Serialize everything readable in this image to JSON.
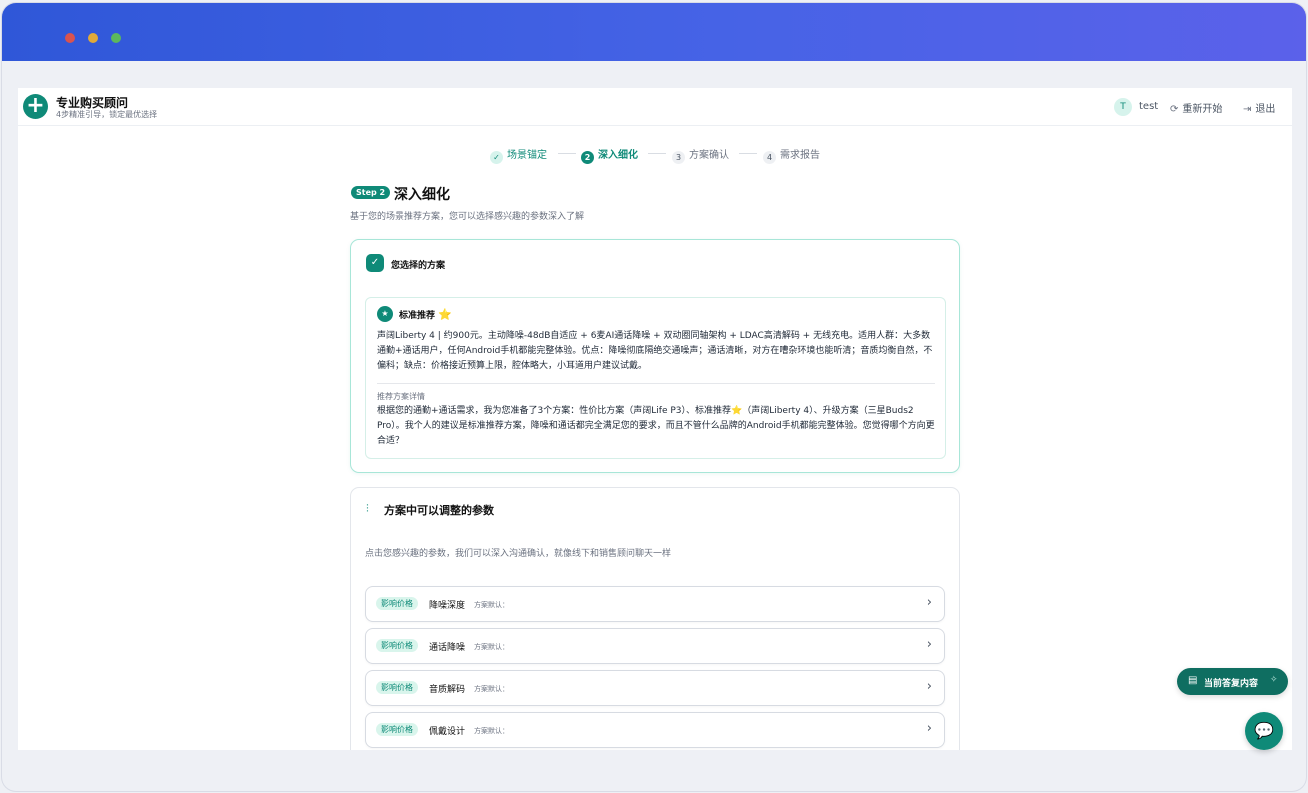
{
  "header": {
    "app_title": "专业购买顾问",
    "app_subtitle": "4步精准引导，锁定最优选择",
    "user_initial": "T",
    "user_name": "test",
    "restart_label": "重新开始",
    "logout_label": "退出"
  },
  "stepper": [
    {
      "num": "✓",
      "label": "场景锚定"
    },
    {
      "num": "2",
      "label": "深入细化"
    },
    {
      "num": "3",
      "label": "方案确认"
    },
    {
      "num": "4",
      "label": "需求报告"
    }
  ],
  "step": {
    "badge": "Step 2",
    "title": "深入细化",
    "desc": "基于您的场景推荐方案，您可以选择感兴趣的参数深入了解"
  },
  "selected_plan": {
    "card_title": "您选择的方案",
    "rec_title": "标准推荐",
    "rec_body": "声阔Liberty 4 | 约900元。主动降噪-48dB自适应 + 6麦AI通话降噪 + 双动圈同轴架构 + LDAC高清解码 + 无线充电。适用人群：大多数通勤+通话用户，任何Android手机都能完整体验。优点：降噪彻底隔绝交通噪声；通话清晰，对方在嘈杂环境也能听清；音质均衡自然，不偏科；缺点：价格接近预算上限，腔体略大，小耳道用户建议试戴。",
    "detail_label": "推荐方案详情",
    "detail_body": "根据您的通勤+通话需求，我为您准备了3个方案：性价比方案（声阔Life P3）、标准推荐⭐（声阔Liberty 4）、升级方案（三星Buds2 Pro）。我个人的建议是标准推荐方案，降噪和通话都完全满足您的要求，而且不管什么品牌的Android手机都能完整体验。您觉得哪个方向更合适？"
  },
  "params": {
    "title": "方案中可以调整的参数",
    "desc": "点击您感兴趣的参数，我们可以深入沟通确认，就像线下和销售顾问聊天一样",
    "items": [
      {
        "tag": "影响价格",
        "name": "降噪深度",
        "default": "方案默认："
      },
      {
        "tag": "影响价格",
        "name": "通话降噪",
        "default": "方案默认："
      },
      {
        "tag": "影响价格",
        "name": "音质解码",
        "default": "方案默认："
      },
      {
        "tag": "影响价格",
        "name": "佩戴设计",
        "default": "方案默认："
      }
    ]
  },
  "float": {
    "current_reply_label": "当前答复内容"
  },
  "colors": {
    "brand": "#0f8a78",
    "titlebar_start": "#2f57d8",
    "titlebar_end": "#5b61ea"
  }
}
